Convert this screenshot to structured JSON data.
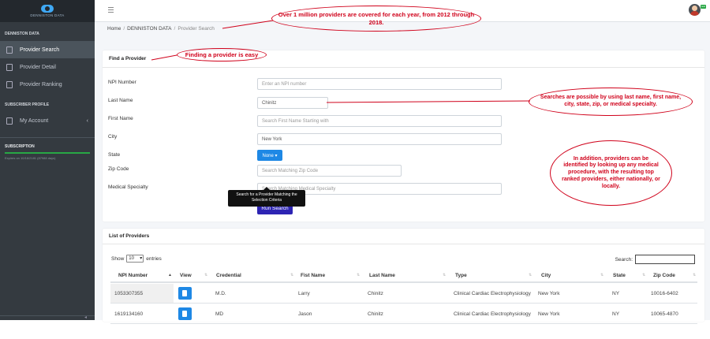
{
  "brand": {
    "name": "DENNISTON DATA"
  },
  "sidebar": {
    "section_main": "DENNISTON DATA",
    "items": [
      {
        "label": "Provider Search",
        "icon": "document-icon",
        "active": true
      },
      {
        "label": "Provider Detail",
        "icon": "document-icon",
        "active": false
      },
      {
        "label": "Provider Ranking",
        "icon": "thumbs-up-icon",
        "active": false
      }
    ],
    "section_profile": "SUBSCRIBER PROFILE",
    "account_label": "My Account",
    "subscription_title": "SUBSCRIPTION",
    "subscription_expiry": "Expires on 10/16/2181 (87988 days)"
  },
  "topbar": {
    "avatar_badge": "test"
  },
  "breadcrumb": {
    "home": "Home",
    "section": "DENNISTON DATA",
    "current": "Provider Search",
    "sep": "/"
  },
  "find": {
    "title": "Find a Provider",
    "npi": {
      "label": "NPI Number",
      "placeholder": "Enter an NPI number"
    },
    "last_name": {
      "label": "Last Name",
      "value": "Chinitz"
    },
    "first_name": {
      "label": "First Name",
      "placeholder": "Search First Name Starting with"
    },
    "city": {
      "label": "City",
      "value": "New York"
    },
    "state": {
      "label": "State",
      "value": "None ▾"
    },
    "zip": {
      "label": "Zip Code",
      "placeholder": "Search Matching Zip Code"
    },
    "specialty": {
      "label": "Medical Specialty",
      "placeholder": "Search Matching Medical Specialty"
    },
    "run_label": "Run Search",
    "tooltip": "Search for a Provider Matching the Selection Criteria"
  },
  "list": {
    "title": "List of Providers",
    "show_prefix": "Show",
    "show_value": "10",
    "show_suffix": "entries",
    "search_label": "Search:",
    "columns": [
      "NPI Number",
      "View",
      "Credential",
      "Fist Name",
      "Last Name",
      "Type",
      "City",
      "State",
      "Zip Code"
    ],
    "rows": [
      {
        "npi": "1053307355",
        "credential": "M.D.",
        "first": "Larry",
        "last": "Chinitz",
        "type": "Clinical Cardiac Electrophysiology",
        "city": "New York",
        "state": "NY",
        "zip": "10016-6402"
      },
      {
        "npi": "1619134160",
        "credential": "MD",
        "first": "Jason",
        "last": "Chinitz",
        "type": "Clinical Cardiac Electrophysiology",
        "city": "New York",
        "state": "NY",
        "zip": "10065-4870"
      }
    ]
  },
  "annotations": {
    "a1": "Over 1 million providers are covered for each year, from 2012 through 2018.",
    "a2": "Finding a provider is easy",
    "a3": "Searches are possible by using last name, first name, city, state, zip, or medical specialty.",
    "a4": "In addition, providers can be identified by looking up any medical procedure, with the resulting top ranked providers, either nationally, or locally."
  },
  "colors": {
    "annotation": "#d0021b",
    "primary": "#1e88e5",
    "run_button": "#2d24b3",
    "sidebar": "#343a40",
    "subscription_bar": "#28a745"
  }
}
